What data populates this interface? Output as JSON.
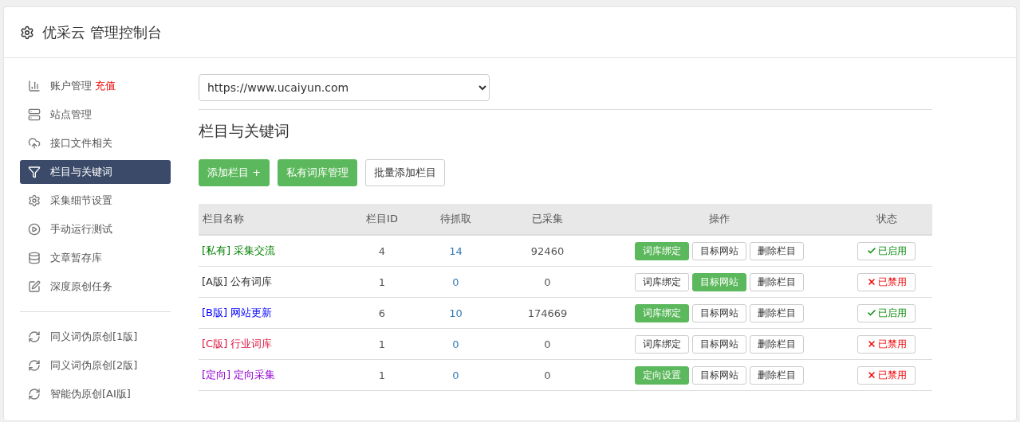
{
  "header": {
    "title": "优采云 管理控制台"
  },
  "sidebar": {
    "groups": [
      [
        {
          "label": "账户管理",
          "badge": "充值",
          "selected": false
        },
        {
          "label": "站点管理",
          "selected": false
        },
        {
          "label": "接口文件相关",
          "selected": false
        },
        {
          "label": "栏目与关键词",
          "selected": true
        },
        {
          "label": "采集细节设置",
          "selected": false
        },
        {
          "label": "手动运行测试",
          "selected": false
        },
        {
          "label": "文章暂存库",
          "selected": false
        },
        {
          "label": "深度原创任务",
          "selected": false
        }
      ],
      [
        {
          "label": "同义词伪原创[1版]",
          "selected": false
        },
        {
          "label": "同义词伪原创[2版]",
          "selected": false
        },
        {
          "label": "智能伪原创[AI版]",
          "selected": false
        }
      ]
    ]
  },
  "site_select": {
    "value": "https://www.ucaiyun.com"
  },
  "section_title": "栏目与关键词",
  "toolbar": [
    {
      "label": "添加栏目 +",
      "primary": true
    },
    {
      "label": "私有词库管理",
      "primary": true
    },
    {
      "label": "批量添加栏目",
      "primary": false
    }
  ],
  "table": {
    "columns": [
      "栏目名称",
      "栏目ID",
      "待抓取",
      "已采集",
      "操作",
      "状态"
    ],
    "rows": [
      {
        "tag": "[私有]",
        "name": "采集交流",
        "color": "#008000",
        "id": "4",
        "pending": "14",
        "collected": "92460",
        "actions": [
          {
            "label": "词库绑定",
            "active": true
          },
          {
            "label": "目标网站",
            "active": false
          },
          {
            "label": "删除栏目",
            "active": false
          }
        ],
        "status": "已启用",
        "enabled": true
      },
      {
        "tag": "[A版]",
        "name": "公有词库",
        "color": "#333333",
        "id": "1",
        "pending": "0",
        "collected": "0",
        "actions": [
          {
            "label": "词库绑定",
            "active": false
          },
          {
            "label": "目标网站",
            "active": true
          },
          {
            "label": "删除栏目",
            "active": false
          }
        ],
        "status": "已禁用",
        "enabled": false
      },
      {
        "tag": "[B版]",
        "name": "网站更新",
        "color": "#0000ff",
        "id": "6",
        "pending": "10",
        "collected": "174669",
        "actions": [
          {
            "label": "词库绑定",
            "active": true
          },
          {
            "label": "目标网站",
            "active": false
          },
          {
            "label": "删除栏目",
            "active": false
          }
        ],
        "status": "已启用",
        "enabled": true
      },
      {
        "tag": "[C版]",
        "name": "行业词库",
        "color": "#dc143c",
        "id": "1",
        "pending": "0",
        "collected": "0",
        "actions": [
          {
            "label": "词库绑定",
            "active": false
          },
          {
            "label": "目标网站",
            "active": false
          },
          {
            "label": "删除栏目",
            "active": false
          }
        ],
        "status": "已禁用",
        "enabled": false
      },
      {
        "tag": "[定向]",
        "name": "定向采集",
        "color": "#9400d3",
        "id": "1",
        "pending": "0",
        "collected": "0",
        "actions": [
          {
            "label": "定向设置",
            "active": true
          },
          {
            "label": "目标网站",
            "active": false
          },
          {
            "label": "删除栏目",
            "active": false
          }
        ],
        "status": "已禁用",
        "enabled": false
      }
    ]
  }
}
